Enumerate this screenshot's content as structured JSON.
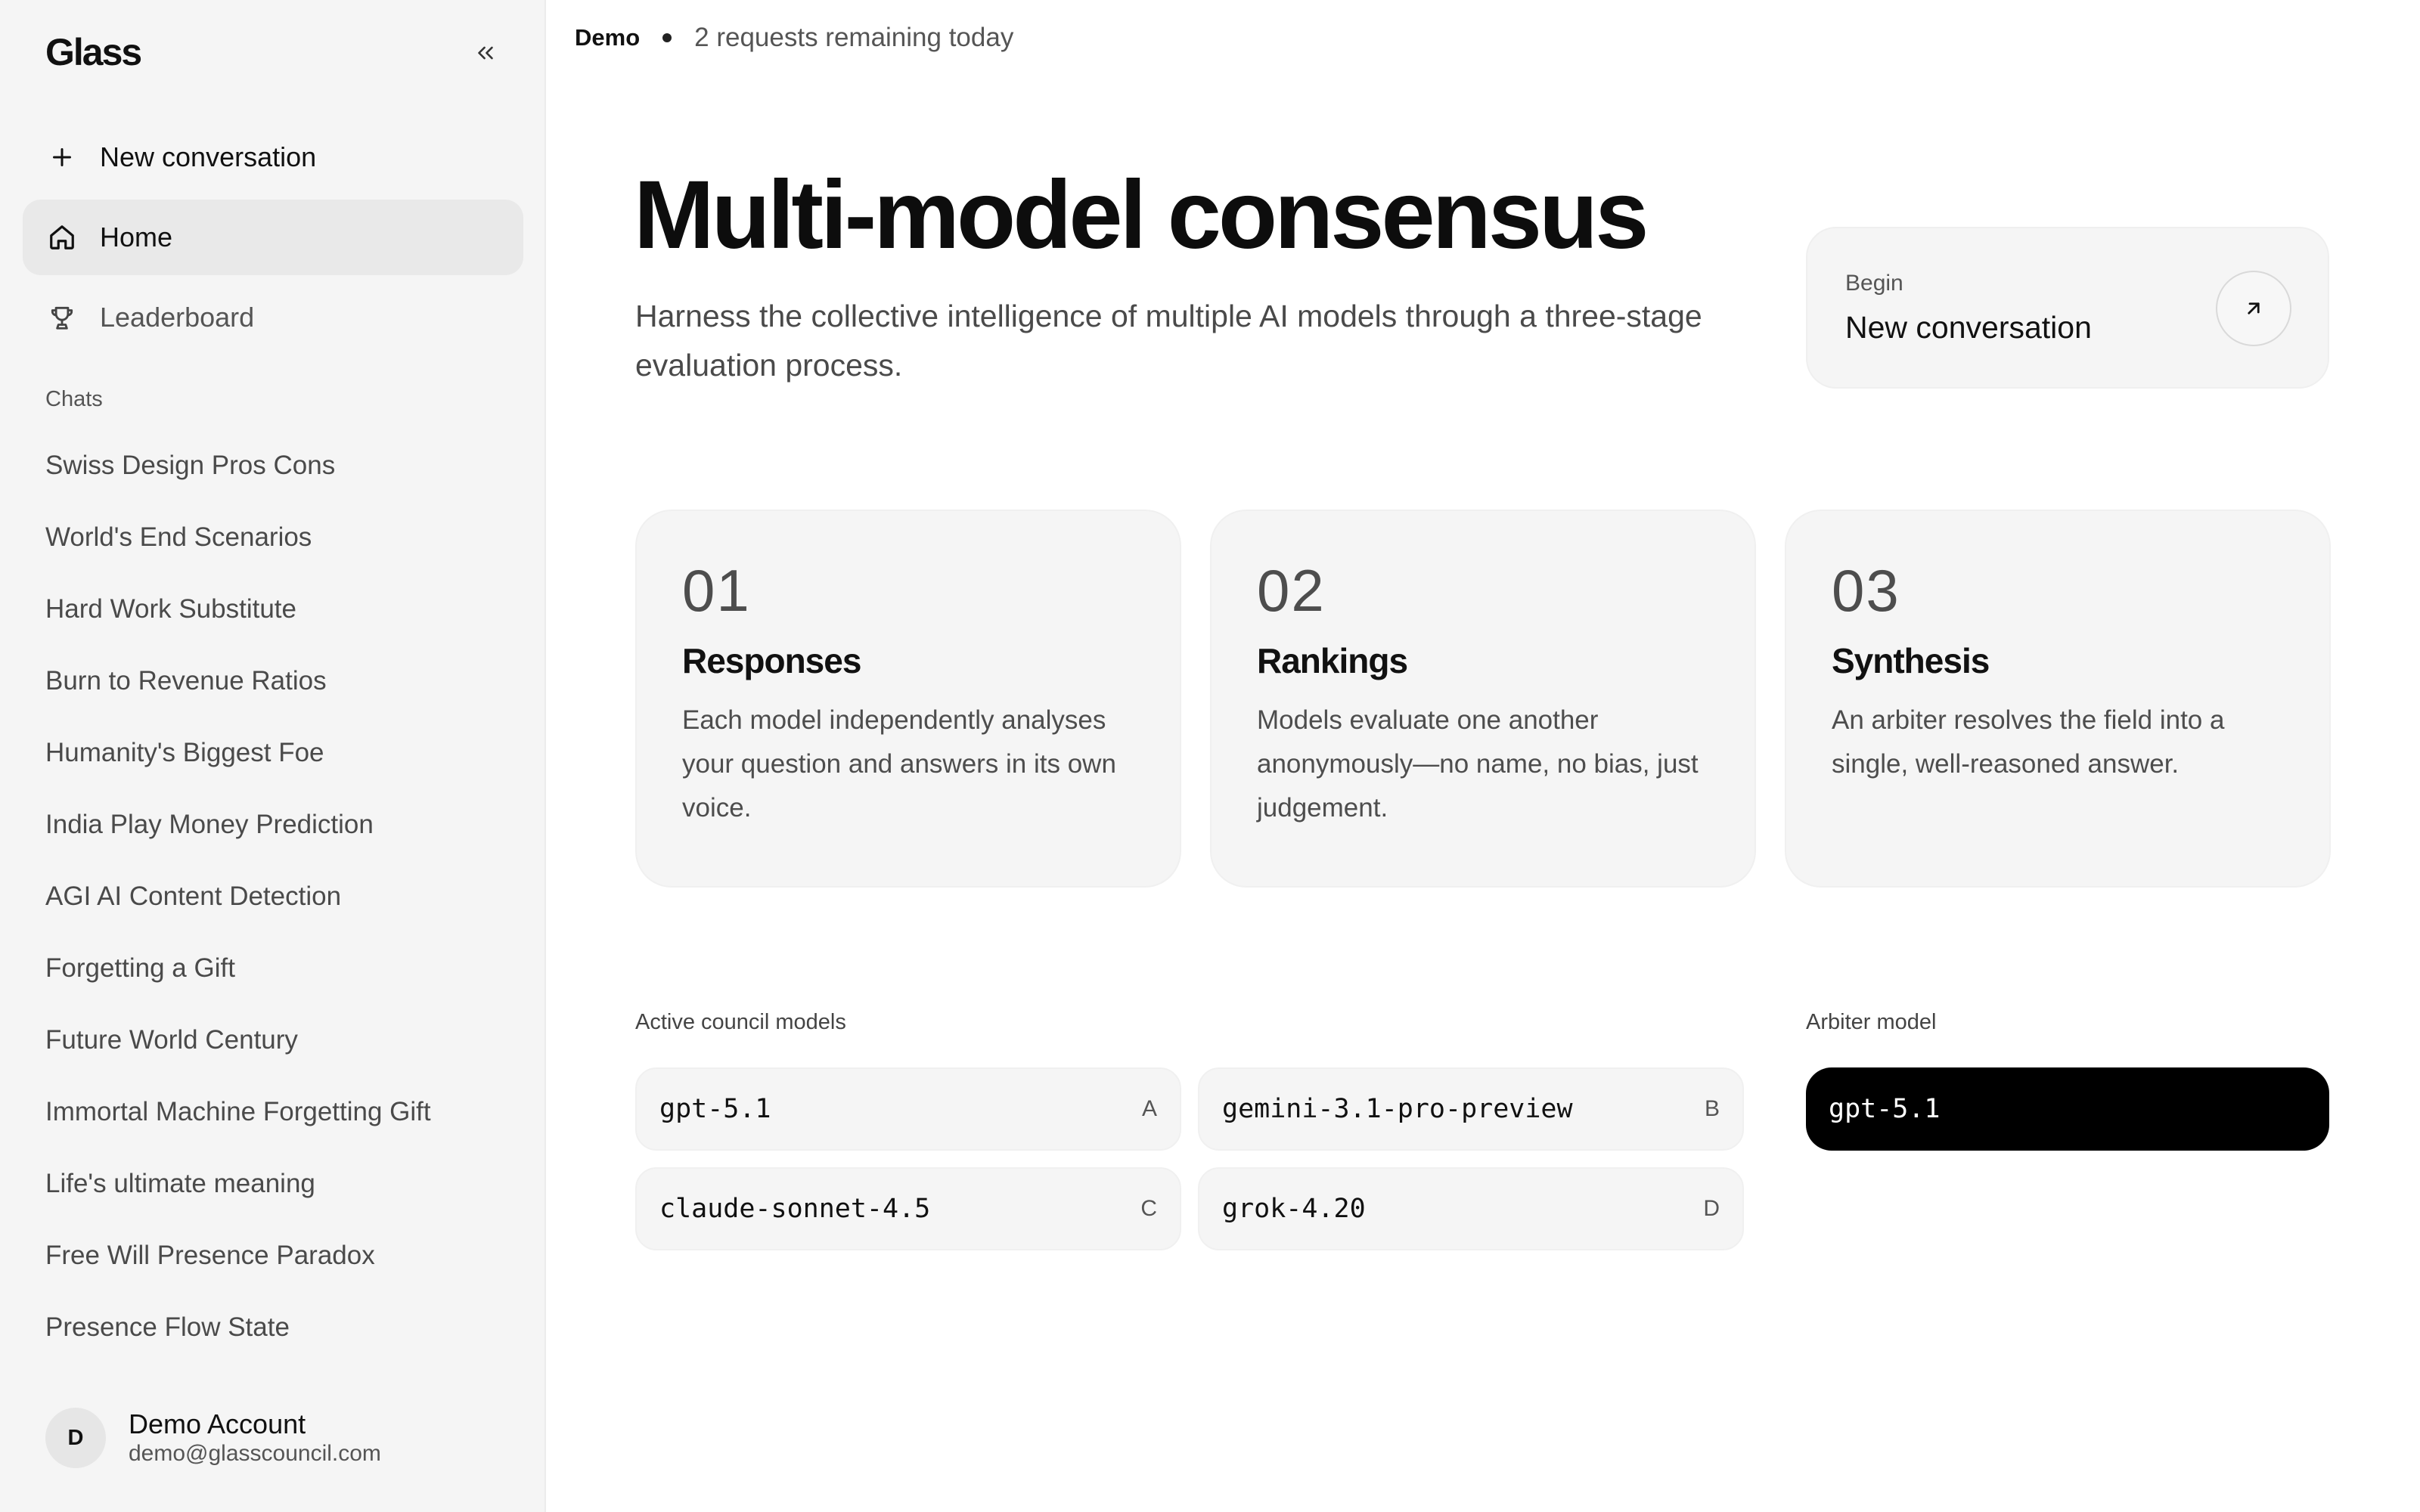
{
  "sidebar": {
    "logo": "Glass",
    "new_conversation": "New conversation",
    "nav": [
      {
        "label": "Home"
      },
      {
        "label": "Leaderboard"
      }
    ],
    "chats_heading": "Chats",
    "chats": [
      "Swiss Design Pros Cons",
      "World's End Scenarios",
      "Hard Work Substitute",
      "Burn to Revenue Ratios",
      "Humanity's Biggest Foe",
      "India Play Money Prediction",
      "AGI AI Content Detection",
      "Forgetting a Gift",
      "Future World Century",
      "Immortal Machine Forgetting Gift",
      "Life's ultimate meaning",
      "Free Will Presence Paradox",
      "Presence Flow State"
    ],
    "account": {
      "initial": "D",
      "name": "Demo Account",
      "email": "demo@glasscouncil.com"
    }
  },
  "status": {
    "mode": "Demo",
    "remaining": "2 requests remaining today"
  },
  "hero": {
    "title": "Multi-model consensus",
    "subtitle": "Harness the collective intelligence of multiple AI models through a three-stage evaluation process."
  },
  "begin_card": {
    "label": "Begin",
    "title": "New conversation"
  },
  "steps": [
    {
      "number": "01",
      "title": "Responses",
      "description": "Each model independently analyses your question and answers in its own voice."
    },
    {
      "number": "02",
      "title": "Rankings",
      "description": "Models evaluate one another anonymously—no name, no bias, just judgement."
    },
    {
      "number": "03",
      "title": "Synthesis",
      "description": "An arbiter resolves the field into a single, well-reasoned answer."
    }
  ],
  "council": {
    "heading": "Active council models",
    "models": [
      {
        "name": "gpt-5.1",
        "letter": "A"
      },
      {
        "name": "gemini-3.1-pro-preview",
        "letter": "B"
      },
      {
        "name": "claude-sonnet-4.5",
        "letter": "C"
      },
      {
        "name": "grok-4.20",
        "letter": "D"
      }
    ]
  },
  "arbiter": {
    "heading": "Arbiter model",
    "model": "gpt-5.1"
  },
  "icons": {
    "collapse": "chevrons-left-icon",
    "new": "plus-icon",
    "home": "home-icon",
    "leaderboard": "trophy-icon",
    "begin_arrow": "arrow-up-right-icon"
  },
  "colors": {
    "sidebar_bg": "#f5f5f5",
    "card_bg": "#f5f5f5",
    "arbiter_bg": "#000000",
    "text": "#111111"
  }
}
